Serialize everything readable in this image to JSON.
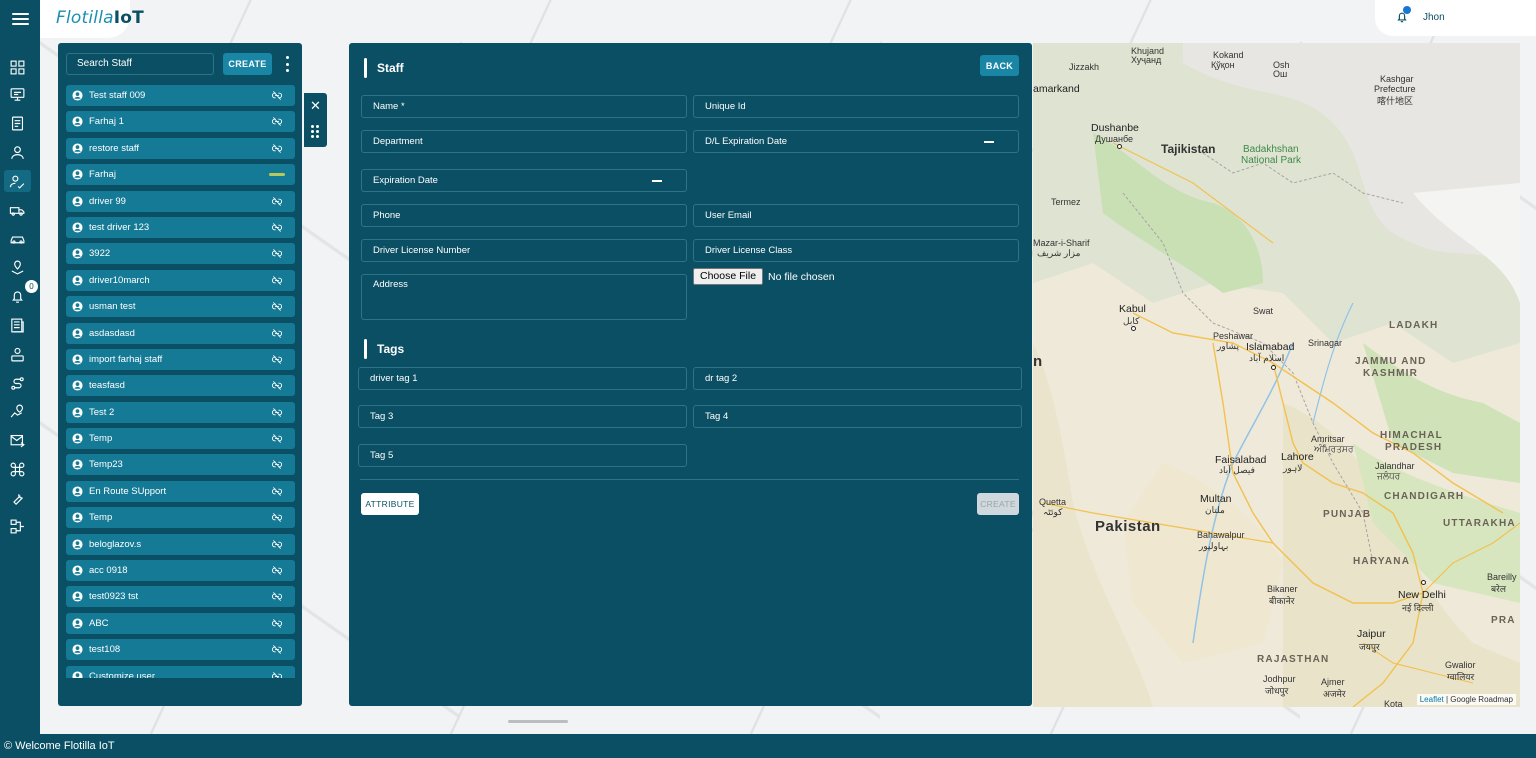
{
  "header": {
    "logo_text": "Flotilla",
    "logo_accent": "IoT",
    "user_name": "Jhon"
  },
  "rail": {
    "notification_count": "0",
    "icons": [
      "dashboard-icon",
      "monitor-icon",
      "report-icon",
      "user-icon",
      "staff-icon",
      "truck-icon",
      "car-icon",
      "geofence-icon",
      "bell-icon",
      "document-icon",
      "driver-icon",
      "route-icon",
      "location-icon",
      "mail-icon",
      "command-icon",
      "wrench-icon",
      "workflow-icon"
    ]
  },
  "staff_panel": {
    "search_placeholder": "Search Staff",
    "create_label": "CREATE",
    "items": [
      {
        "name": "Test staff 009",
        "icon": "unlink-icon"
      },
      {
        "name": "Farhaj 1",
        "icon": "unlink-icon"
      },
      {
        "name": "restore staff",
        "icon": "unlink-icon"
      },
      {
        "name": "Farhaj",
        "icon": "bar-icon"
      },
      {
        "name": "driver 99",
        "icon": "unlink-icon"
      },
      {
        "name": "test driver 123",
        "icon": "unlink-icon"
      },
      {
        "name": "3922",
        "icon": "unlink-icon"
      },
      {
        "name": "driver10march",
        "icon": "unlink-icon"
      },
      {
        "name": "usman test",
        "icon": "unlink-icon"
      },
      {
        "name": "asdasdasd",
        "icon": "unlink-icon"
      },
      {
        "name": "import farhaj staff",
        "icon": "unlink-icon"
      },
      {
        "name": "teasfasd",
        "icon": "unlink-icon"
      },
      {
        "name": "Test 2",
        "icon": "unlink-icon"
      },
      {
        "name": "Temp",
        "icon": "unlink-icon"
      },
      {
        "name": "Temp23",
        "icon": "unlink-icon"
      },
      {
        "name": "En Route SUpport",
        "icon": "unlink-icon"
      },
      {
        "name": "Temp",
        "icon": "unlink-icon"
      },
      {
        "name": "beloglazov.s",
        "icon": "unlink-icon"
      },
      {
        "name": "acc 0918",
        "icon": "unlink-icon"
      },
      {
        "name": "test0923 tst",
        "icon": "unlink-icon"
      },
      {
        "name": "ABC",
        "icon": "unlink-icon"
      },
      {
        "name": "test108",
        "icon": "unlink-icon"
      },
      {
        "name": "Customize user",
        "icon": "unlink-icon"
      }
    ]
  },
  "form": {
    "title": "Staff",
    "back_label": "BACK",
    "fields": {
      "name": "Name *",
      "unique_id": "Unique Id",
      "department": "Department",
      "dl_expiration": "D/L Expiration Date",
      "expiration": "Expiration Date",
      "phone": "Phone",
      "user_email": "User Email",
      "license_number": "Driver License Number",
      "license_class": "Driver License Class",
      "address": "Address"
    },
    "file_button": "Choose File",
    "file_status": "No file chosen",
    "tags_title": "Tags",
    "tags": {
      "tag1": "driver tag 1",
      "tag2": "dr tag 2",
      "tag3": "Tag 3",
      "tag4": "Tag 4",
      "tag5": "Tag 5"
    },
    "attribute_label": "ATTRIBUTE",
    "create_label": "CREATE"
  },
  "map": {
    "labels": {
      "khujand": "Khujand",
      "khujand_local": "Хуҷанд",
      "kokand": "Kokand",
      "kokand_local": "Қўқон",
      "osh": "Osh",
      "osh_local": "Ош",
      "jizzakh": "Jizzakh",
      "samarkand": "amarkand",
      "kashgar": "Kashgar",
      "kashgar_sub": "Prefecture",
      "kashgar_local": "喀什地区",
      "dushanbe": "Dushanbe",
      "dushanbe_local": "Душанбе",
      "tajikistan": "Tajikistan",
      "badakhshan": "Badakhshan",
      "badakhshan_sub": "National Park",
      "termez": "Termez",
      "mazar": "Mazar-i-Sharif",
      "mazar_local": "مزار شریف",
      "kabul": "Kabul",
      "kabul_local": "کابل",
      "swat": "Swat",
      "peshawar": "Peshawar",
      "peshawar_local": "پشاور",
      "islamabad": "Islamabad",
      "islamabad_local": "اسلام آباد",
      "srinagar": "Srinagar",
      "ladakh": "LADAKH",
      "jammu": "JAMMU AND",
      "kashmir": "KASHMIR",
      "edge_n": "n",
      "amritsar": "Amritsar",
      "amritsar_local": "ਅੰਮ੍ਰਿਤਸਰ",
      "himachal": "HIMACHAL",
      "pradesh": "PRADESH",
      "faisalabad": "Faisalabad",
      "faisalabad_local": "فیصل آباد",
      "lahore": "Lahore",
      "lahore_local": "لاہور",
      "jalandhar": "Jalandhar",
      "jalandhar_local": "ਜਲੰਧਰ",
      "quetta": "Quetta",
      "quetta_local": "کوئٹہ",
      "multan": "Multan",
      "multan_local": "ملتان",
      "chandigarh": "CHANDIGARH",
      "pakistan": "Pakistan",
      "punjab": "PUNJAB",
      "uttarakhand": "UTTARAKHA",
      "bahawalpur": "Bahawalpur",
      "bahawalpur_local": "بہاولپور",
      "haryana": "HARYANA",
      "bareilly": "Bareilly",
      "bareilly_local": "बरेल",
      "bikaner": "Bikaner",
      "bikaner_local": "बीकानेर",
      "new_delhi": "New Delhi",
      "new_delhi_local": "नई दिल्ली",
      "edge_pra": "PRA",
      "jaipur": "Jaipur",
      "jaipur_local": "जयपुर",
      "rajasthan": "RAJASTHAN",
      "gwalior": "Gwalior",
      "gwalior_local": "ग्वालियर",
      "ajmer": "Ajmer",
      "ajmer_local": "अजमेर",
      "jodhpur": "Jodhpur",
      "jodhpur_local": "जोधपुर",
      "kota": "Kota"
    },
    "attribution_link": "Leaflet",
    "attribution_text": "| Google Roadmap"
  },
  "footer": {
    "text": "© Welcome Flotilla IoT"
  }
}
